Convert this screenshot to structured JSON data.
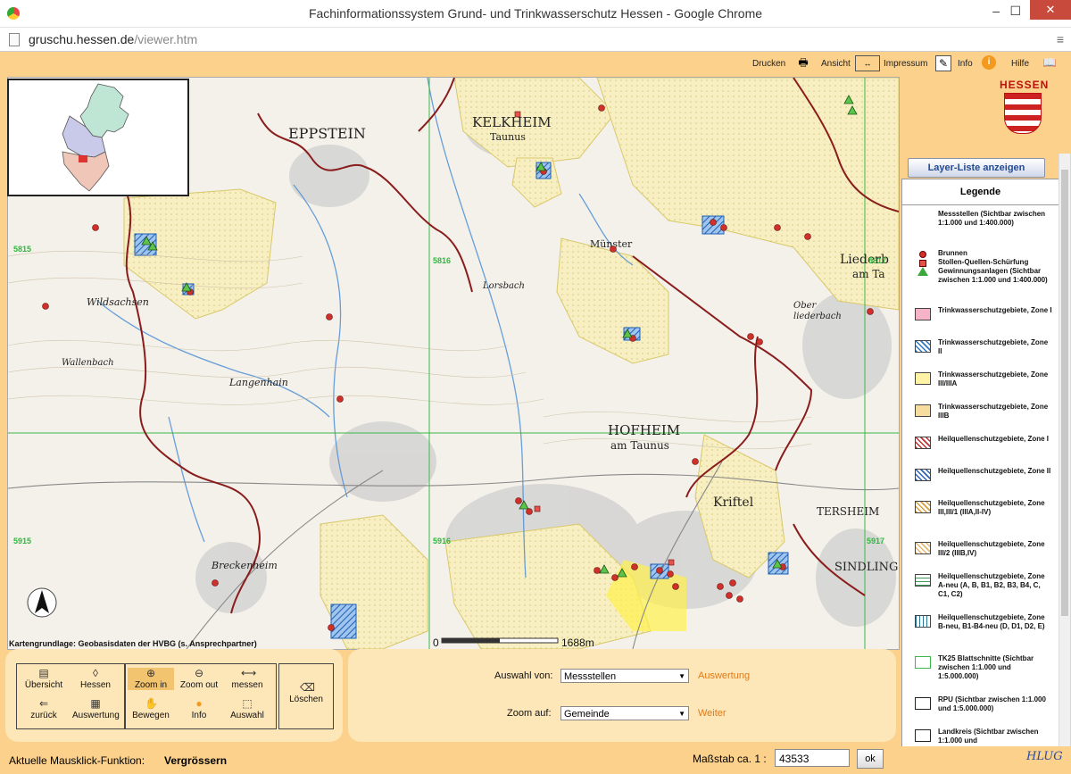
{
  "window": {
    "title": "Fachinformationssystem Grund- und Trinkwasserschutz Hessen - Google Chrome",
    "url_host": "gruschu.hessen.de",
    "url_path": "/viewer.htm"
  },
  "toolbar": {
    "print": "Drucken",
    "view": "Ansicht",
    "imprint": "Impressum",
    "info": "Info",
    "help": "Hilfe"
  },
  "logo": {
    "word": "HESSEN"
  },
  "map": {
    "credit": "Kartengrundlage: Geobasisdaten der HVBG (s. Ansprechpartner)",
    "scalebar": {
      "left": "0",
      "right": "1688m"
    },
    "labels": {
      "eppstein": "EPPSTEIN",
      "kelkheim": "KELKHEIM",
      "kelkheim_sub": "Taunus",
      "wildsachsen": "Wildsachsen",
      "langenhain": "Langenhain",
      "lorsbach": "Lorsbach",
      "munster": "Münster",
      "hofheim": "HOFHEIM",
      "hofheim_sub": "am Taunus",
      "kriftel": "Kriftel",
      "breckenheim": "Breckenheim",
      "liederbach": "Liederb",
      "liederbach_sub": "am Ta",
      "oberliederbach": "Ober",
      "oberliederbach_sub": "liederbach",
      "hattersheim": "TERSHEIM",
      "sindlingen": "SINDLING",
      "wallau": "Wallenbach"
    },
    "grid_labels": [
      "5815",
      "5915",
      "5916",
      "5917",
      "5816",
      "5817"
    ]
  },
  "layer_button": "Layer-Liste anzeigen",
  "legend": {
    "title": "Legende",
    "items": [
      {
        "label": "Messstellen (Sichtbar zwischen 1:1.000 und 1:400.000)",
        "type": "header"
      },
      {
        "label": "Brunnen",
        "type": "dot",
        "color": "#d0302a"
      },
      {
        "label": "Stollen-Quellen-Schürfung",
        "type": "square",
        "color": "#e2544a"
      },
      {
        "label": "Gewinnungsanlagen (Sichtbar zwischen 1:1.000 und 1:400.000)",
        "type": "triangle",
        "color": "#3aa83a"
      },
      {
        "label": "Trinkwasserschutzgebiete, Zone I",
        "type": "fill",
        "color": "#f7b3c8"
      },
      {
        "label": "Trinkwasserschutzgebiete, Zone II",
        "type": "hatch",
        "color": "#2d78c8"
      },
      {
        "label": "Trinkwasserschutzgebiete, Zone III/IIIA",
        "type": "fill",
        "color": "#fff3a6"
      },
      {
        "label": "Trinkwasserschutzgebiete, Zone IIIB",
        "type": "fill",
        "color": "#f7dca0"
      },
      {
        "label": "Heilquellenschutzgebiete, Zone I",
        "type": "hatch",
        "color": "#c03030"
      },
      {
        "label": "Heilquellenschutzgebiete, Zone II",
        "type": "hatch",
        "color": "#2d62b8"
      },
      {
        "label": "Heilquellenschutzgebiete, Zone III,III/1 (IIIA,II-IV)",
        "type": "hatch",
        "color": "#d9a040"
      },
      {
        "label": "Heilquellenschutzgebiete, Zone III/2 (IIIB,IV)",
        "type": "hatch",
        "color": "#e6b870"
      },
      {
        "label": "Heilquellenschutzgebiete, Zone A-neu (A, B, B1, B2, B3, B4, C, C1, C2)",
        "type": "hlines",
        "color": "#3a9a5a"
      },
      {
        "label": "Heilquellenschutzgebiete, Zone B-neu, B1-B4-neu (D, D1, D2, E)",
        "type": "vlines",
        "color": "#2a7a9a"
      },
      {
        "label": "TK25 Blattschnitte (Sichtbar zwischen 1:1.000 und 1:5.000.000)",
        "type": "outline",
        "color": "#3ab84a"
      },
      {
        "label": "RPU (Sichtbar zwischen 1:1.000 und 1:5.000.000)",
        "type": "outline",
        "color": "#222222"
      },
      {
        "label": "Landkreis (Sichtbar zwischen 1:1.000 und",
        "type": "outline",
        "color": "#222222"
      }
    ]
  },
  "tools": {
    "overview": "Übersicht",
    "hessen": "Hessen",
    "back": "zurück",
    "evaluation": "Auswertung",
    "zoom_in": "Zoom in",
    "zoom_out": "Zoom out",
    "measure": "messen",
    "pan": "Bewegen",
    "info": "Info",
    "select": "Auswahl",
    "delete": "Löschen"
  },
  "query": {
    "selection_label": "Auswahl von:",
    "selection_value": "Messstellen",
    "selection_link": "Auswertung",
    "zoom_label": "Zoom auf:",
    "zoom_value": "Gemeinde",
    "zoom_link": "Weiter"
  },
  "status": {
    "label": "Aktuelle Mausklick-Funktion:",
    "value": "Vergrössern",
    "scale_label": "Maßstab ca. 1 :",
    "scale_value": "43533",
    "ok": "ok",
    "brand": "HLUG"
  }
}
